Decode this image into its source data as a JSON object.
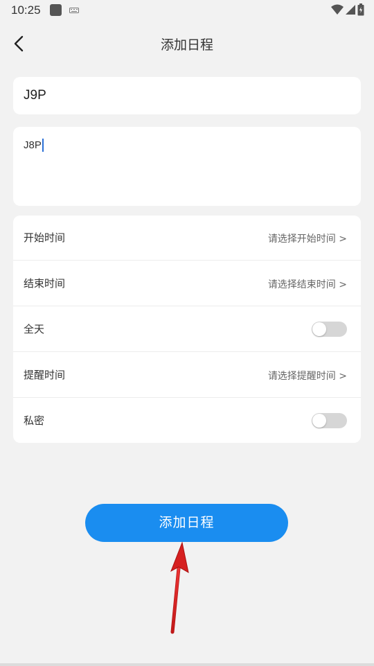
{
  "status_bar": {
    "time": "10:25"
  },
  "header": {
    "title": "添加日程",
    "back_icon": "chevron-left-icon"
  },
  "form": {
    "title_value": "J9P",
    "description_value": "J8P"
  },
  "rows": [
    {
      "label": "开始时间",
      "value": "请选择开始时间 >",
      "type": "picker"
    },
    {
      "label": "结束时间",
      "value": "请选择结束时间 >",
      "type": "picker"
    },
    {
      "label": "全天",
      "type": "toggle",
      "on": false
    },
    {
      "label": "提醒时间",
      "value": "请选择提醒时间 >",
      "type": "picker"
    },
    {
      "label": "私密",
      "type": "toggle",
      "on": false
    }
  ],
  "primary_button": {
    "label": "添加日程",
    "color": "#1a8df0"
  },
  "colors": {
    "background": "#f2f2f2",
    "card": "#ffffff",
    "annotation_arrow": "#e02a2a",
    "caret": "#2a6fd6"
  }
}
